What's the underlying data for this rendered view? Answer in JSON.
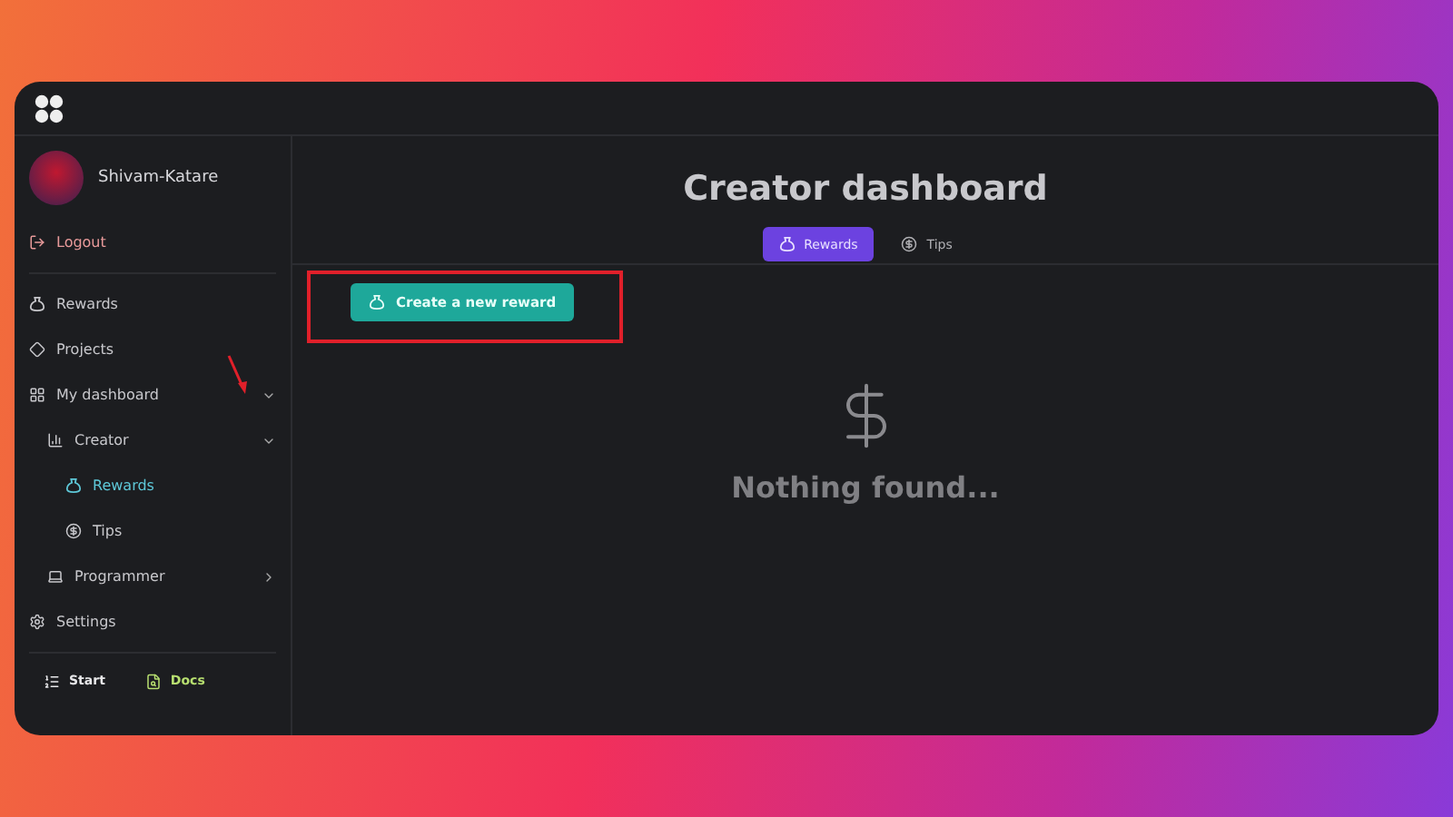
{
  "user": {
    "name": "Shivam-Katare",
    "logout": "Logout"
  },
  "nav": [
    {
      "label": "Rewards",
      "selected": false
    },
    {
      "label": "Projects",
      "selected": false
    },
    {
      "label": "My dashboard",
      "selected": false,
      "expanded": true,
      "children": [
        {
          "label": "Creator",
          "selected": false,
          "expanded": true,
          "children": [
            {
              "label": "Rewards",
              "selected": true
            },
            {
              "label": "Tips",
              "selected": false
            }
          ]
        },
        {
          "label": "Programmer",
          "selected": false,
          "expanded": false
        }
      ]
    },
    {
      "label": "Settings",
      "selected": false
    }
  ],
  "footer": [
    {
      "label": "Start"
    },
    {
      "label": "Docs"
    }
  ],
  "main": {
    "title": "Creator dashboard",
    "tabs": [
      {
        "label": "Rewards",
        "selected": true
      },
      {
        "label": "Tips",
        "selected": false
      }
    ],
    "create_button": "Create a new reward",
    "empty_message": "Nothing found..."
  }
}
